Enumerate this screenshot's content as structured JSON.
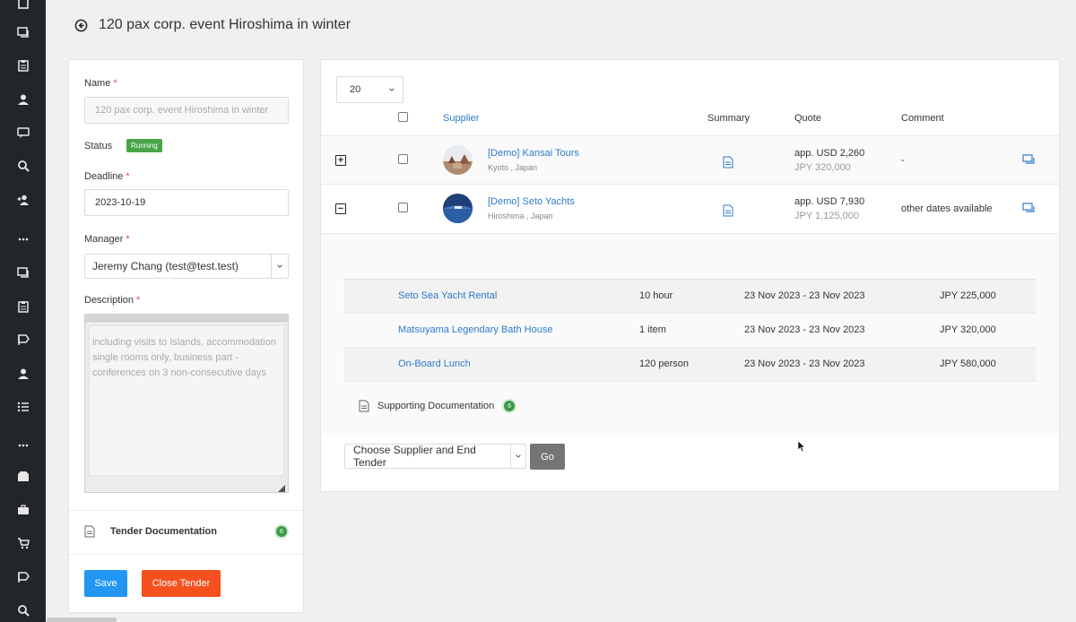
{
  "sidebar": {
    "icons": [
      "doc-icon",
      "chat-icon",
      "clipboard-icon",
      "user-icon",
      "chat-icon",
      "search-icon",
      "add-user-icon",
      "more-icon",
      "chat-icon",
      "clipboard-icon",
      "flag-icon",
      "user-icon",
      "list-icon",
      "more-icon",
      "box-icon",
      "briefcase-icon",
      "cart-icon",
      "flag-icon",
      "search-icon"
    ]
  },
  "header": {
    "title": "120 pax corp. event Hiroshima in winter"
  },
  "form": {
    "name_label": "Name",
    "name_value": "120 pax corp. event Hiroshima in winter",
    "status_label": "Status",
    "status_value": "Running",
    "deadline_label": "Deadline",
    "deadline_value": "2023-10-19",
    "manager_label": "Manager",
    "manager_value": "Jeremy Chang (test@test.test)",
    "description_label": "Description",
    "description_value": "including visits to Islands, accommodation single rooms only, business part - conferences on 3 non-consecutive days",
    "required_mark": "*",
    "tender_doc_label": "Tender Documentation",
    "tender_doc_count": "6",
    "save_label": "Save",
    "close_label": "Close Tender"
  },
  "table": {
    "per_page": "20",
    "headers": {
      "supplier": "Supplier",
      "summary": "Summary",
      "quote": "Quote",
      "comment": "Comment"
    },
    "rows": [
      {
        "expander": "+",
        "name": "[Demo] Kansai Tours",
        "location": "Kyoto , Japan",
        "quote_main": "app. USD 2,260",
        "quote_sub": "JPY 320,000",
        "comment": "-"
      },
      {
        "expander": "−",
        "name": "[Demo] Seto Yachts",
        "location": "Hiroshima , Japan",
        "quote_main": "app. USD 7,930",
        "quote_sub": "JPY 1,125,000",
        "comment": "other dates available"
      }
    ],
    "details": [
      {
        "service": "Seto Sea Yacht Rental",
        "qty": "10 hour",
        "dates": "23 Nov 2023 - 23 Nov 2023",
        "price": "JPY 225,000"
      },
      {
        "service": "Matsuyama Legendary Bath House",
        "qty": "1 item",
        "dates": "23 Nov 2023 - 23 Nov 2023",
        "price": "JPY 320,000"
      },
      {
        "service": "On-Board Lunch",
        "qty": "120 person",
        "dates": "23 Nov 2023 - 23 Nov 2023",
        "price": "JPY 580,000"
      }
    ],
    "supporting_doc_label": "Supporting Documentation",
    "supporting_doc_count": "6",
    "end_tender_select": "Choose Supplier and End Tender",
    "go_label": "Go"
  },
  "colors": {
    "sidebar_bg": "#22262b",
    "link": "#2b7bc9",
    "save": "#2196f3",
    "close": "#f4511e",
    "running": "#47a447"
  }
}
